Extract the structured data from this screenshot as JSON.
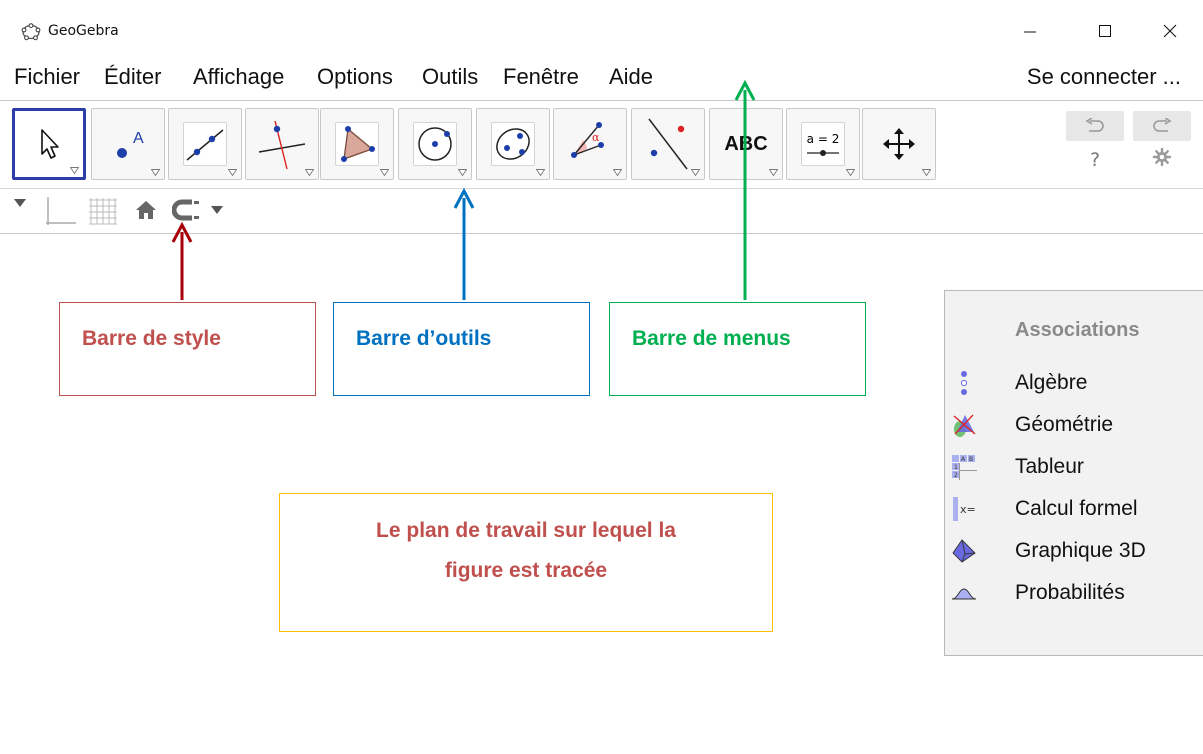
{
  "window": {
    "title": "GeoGebra",
    "minimize_icon": "minimize-icon",
    "maximize_icon": "maximize-icon",
    "close_icon": "close-icon"
  },
  "menubar": {
    "items": [
      "Fichier",
      "Éditer",
      "Affichage",
      "Options",
      "Outils",
      "Fenêtre",
      "Aide"
    ],
    "login": "Se connecter ..."
  },
  "toolbar": {
    "tools": [
      {
        "name": "move-tool",
        "icon": "cursor-arrow-icon",
        "selected": true
      },
      {
        "name": "point-tool",
        "icon": "point-a-icon"
      },
      {
        "name": "line-tool",
        "icon": "line-through-two-points-icon"
      },
      {
        "name": "perpendicular-line-tool",
        "icon": "perpendicular-line-icon"
      },
      {
        "name": "polygon-tool",
        "icon": "polygon-icon"
      },
      {
        "name": "circle-tool",
        "icon": "circle-center-point-icon"
      },
      {
        "name": "ellipse-tool",
        "icon": "ellipse-icon"
      },
      {
        "name": "angle-tool",
        "icon": "angle-icon",
        "label": "α"
      },
      {
        "name": "reflect-tool",
        "icon": "reflect-about-line-icon"
      },
      {
        "name": "text-tool",
        "label": "ABC"
      },
      {
        "name": "slider-tool",
        "label": "a = 2"
      },
      {
        "name": "move-graphics-view-tool",
        "icon": "move-view-icon"
      }
    ],
    "undo_icon": "undo-icon",
    "redo_icon": "redo-icon",
    "help_label": "?",
    "settings_icon": "gear-icon"
  },
  "stylebar": {
    "items": [
      "toggle-stylebar-icon",
      "axes-icon",
      "grid-icon",
      "home-icon",
      "point-capturing-icon",
      "dropdown-arrow-icon"
    ]
  },
  "annotations": {
    "style_bar": "Barre de style",
    "tool_bar": "Barre d’outils",
    "menu_bar": "Barre de menus",
    "workspace_line1": "Le plan de travail sur lequel la",
    "workspace_line2": "figure est tracée"
  },
  "perspectives": {
    "title": "Associations",
    "items": [
      {
        "label": "Algèbre",
        "icon": "algebra-icon"
      },
      {
        "label": "Géométrie",
        "icon": "geometry-icon"
      },
      {
        "label": "Tableur",
        "icon": "spreadsheet-icon"
      },
      {
        "label": "Calcul formel",
        "icon": "cas-icon"
      },
      {
        "label": "Graphique 3D",
        "icon": "graphics-3d-icon"
      },
      {
        "label": "Probabilités",
        "icon": "probability-icon"
      }
    ]
  },
  "colors": {
    "style_bar_annotation": "#c0504d",
    "tool_bar_annotation": "#0070c0",
    "menu_bar_annotation": "#00b050",
    "workspace_border": "#ffc000",
    "selected_tool_border": "#2b3ea8",
    "arrow_red": "#a8000a",
    "arrow_blue": "#0070c0",
    "arrow_green": "#00b050"
  }
}
